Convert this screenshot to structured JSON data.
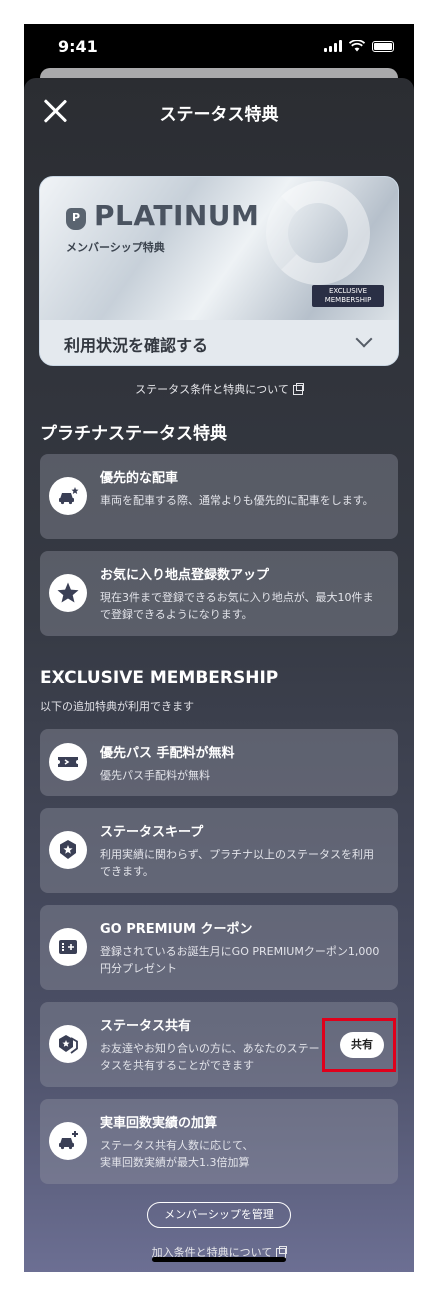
{
  "status_bar": {
    "time": "9:41"
  },
  "header": {
    "title": "ステータス特典"
  },
  "card": {
    "tier": "PLATINUM",
    "tier_initial": "P",
    "subtitle": "メンバーシップ特典",
    "badge_line1": "EXCLUSIVE",
    "badge_line2": "MEMBERSHIP",
    "usage_label": "利用状況を確認する"
  },
  "links": {
    "status_conditions": "ステータス条件と特典について",
    "join_conditions": "加入条件と特典について"
  },
  "platinum_section": {
    "title": "プラチナステータス特典",
    "benefits": [
      {
        "title": "優先的な配車",
        "desc": "車両を配車する際、通常よりも優先的に配車をします。",
        "icon": "priority-car-icon"
      },
      {
        "title": "お気に入り地点登録数アップ",
        "desc": "現在3件まで登録できるお気に入り地点が、最大10件まで登録できるようになります。",
        "icon": "star-icon"
      }
    ]
  },
  "exclusive_section": {
    "title": "EXCLUSIVE MEMBERSHIP",
    "subtitle": "以下の追加特典が利用できます",
    "benefits": [
      {
        "title": "優先パス 手配料が無料",
        "desc": "優先パス手配料が無料",
        "icon": "ticket-icon"
      },
      {
        "title": "ステータスキープ",
        "desc": "利用実績に関わらず、プラチナ以上のステータスを利用できます。",
        "icon": "status-keep-icon"
      },
      {
        "title": "GO PREMIUM クーポン",
        "desc": "登録されているお誕生月にGO PREMIUMクーポン1,000円分プレゼント",
        "icon": "coupon-icon"
      },
      {
        "title": "ステータス共有",
        "desc": "お友達やお知り合いの方に、あなたのステータスを共有することができます",
        "icon": "status-share-icon",
        "button": "共有"
      },
      {
        "title": "実車回数実績の加算",
        "desc1": "ステータス共有人数に応じて、",
        "desc2": "実車回数実績が最大1.3倍加算",
        "icon": "ride-count-icon"
      }
    ]
  },
  "footer": {
    "manage_label": "メンバーシップを管理"
  },
  "colors": {
    "highlight": "#e0001b",
    "sheet_top": "#2b2d32",
    "sheet_bottom": "#6c6f93"
  }
}
